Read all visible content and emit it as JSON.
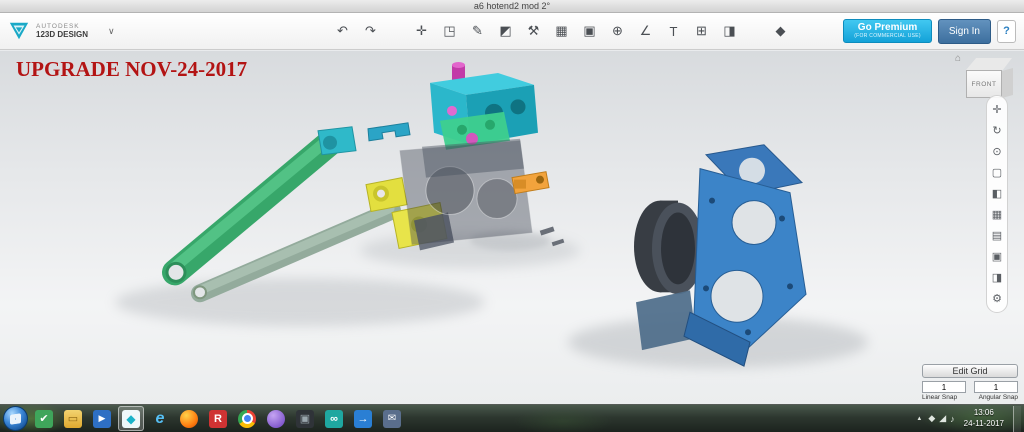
{
  "titlebar": {
    "title": "a6 hotend2 mod 2°"
  },
  "toolbar": {
    "brand_top": "AUTODESK",
    "brand_bottom": "123D DESIGN",
    "menu_chevron": "∨",
    "icons": [
      {
        "name": "undo",
        "glyph": "↶"
      },
      {
        "name": "redo",
        "glyph": "↷"
      },
      {
        "name": "transform",
        "glyph": "✛"
      },
      {
        "name": "primitives",
        "glyph": "◳"
      },
      {
        "name": "sketch",
        "glyph": "✎"
      },
      {
        "name": "construct",
        "glyph": "◩"
      },
      {
        "name": "modify",
        "glyph": "⚒"
      },
      {
        "name": "pattern",
        "glyph": "▦"
      },
      {
        "name": "grouping",
        "glyph": "▣"
      },
      {
        "name": "combine",
        "glyph": "⊕"
      },
      {
        "name": "measure",
        "glyph": "∠"
      },
      {
        "name": "text",
        "glyph": "T"
      },
      {
        "name": "snap",
        "glyph": "⊞"
      },
      {
        "name": "view",
        "glyph": "◨"
      },
      {
        "name": "material",
        "glyph": "◆"
      }
    ],
    "go_premium_label": "Go Premium",
    "go_premium_sublabel": "(FOR COMMERCIAL USE)",
    "sign_in_label": "Sign In",
    "help_label": "?"
  },
  "viewport": {
    "annotation": "UPGRADE NOV-24-2017",
    "viewcube": {
      "front_label": "FRONT",
      "home_glyph": "⌂"
    },
    "right_tools": [
      {
        "name": "pan",
        "glyph": "✛"
      },
      {
        "name": "orbit",
        "glyph": "↻"
      },
      {
        "name": "zoom",
        "glyph": "⊙"
      },
      {
        "name": "fit-view",
        "glyph": "▢"
      },
      {
        "name": "shaded-view",
        "glyph": "◧"
      },
      {
        "name": "wireframe-view",
        "glyph": "▦"
      },
      {
        "name": "hidden-edges",
        "glyph": "▤"
      },
      {
        "name": "screenshot",
        "glyph": "▣"
      },
      {
        "name": "outline-view",
        "glyph": "◨"
      },
      {
        "name": "view-settings",
        "glyph": "⚙"
      }
    ]
  },
  "grid_panel": {
    "edit_grid_label": "Edit Grid",
    "linear_snap_value": "1",
    "angular_snap_value": "1",
    "linear_snap_label": "Linear Snap",
    "angular_snap_label": "Angular Snap"
  },
  "taskbar": {
    "apps": [
      {
        "name": "antivirus",
        "glyph": "✔"
      },
      {
        "name": "folder",
        "glyph": "▭"
      },
      {
        "name": "media-player",
        "glyph": "▶"
      },
      {
        "name": "123d-design",
        "glyph": "◆"
      },
      {
        "name": "internet-explorer",
        "glyph": "e"
      },
      {
        "name": "firefox",
        "glyph": ""
      },
      {
        "name": "realplayer",
        "glyph": "R"
      },
      {
        "name": "chrome",
        "glyph": ""
      },
      {
        "name": "messenger",
        "glyph": ""
      },
      {
        "name": "utility",
        "glyph": "▣"
      },
      {
        "name": "photo-tool",
        "glyph": "∞"
      },
      {
        "name": "downloader",
        "glyph": "→"
      },
      {
        "name": "mail",
        "glyph": "✉"
      }
    ],
    "tray_expand_glyph": "▲",
    "tray_icons": [
      {
        "name": "tray-status",
        "glyph": "◆"
      },
      {
        "name": "tray-network",
        "glyph": "◢"
      },
      {
        "name": "tray-volume",
        "glyph": "♪"
      }
    ],
    "clock_time": "13:06",
    "clock_date": "24-11-2017"
  }
}
